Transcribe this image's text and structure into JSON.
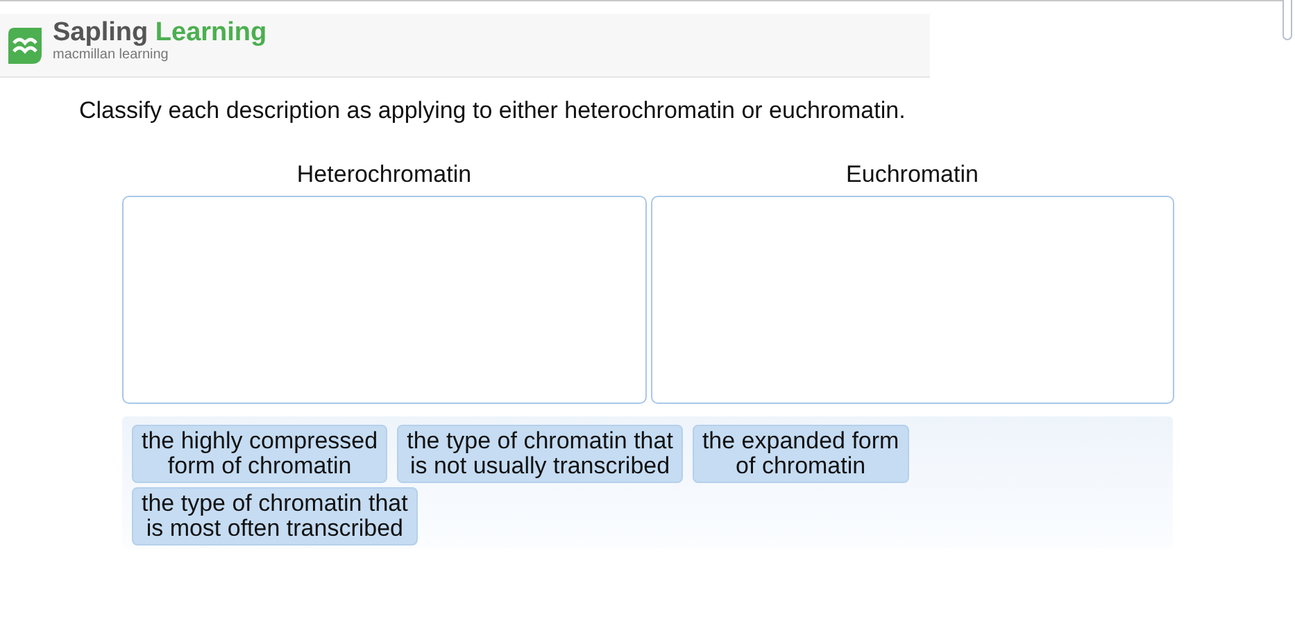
{
  "header": {
    "brand_primary": "Sapling",
    "brand_secondary": "Learning",
    "tagline": "macmillan learning"
  },
  "question": "Classify each description as applying to either heterochromatin or euchromatin.",
  "bins": [
    {
      "label": "Heterochromatin"
    },
    {
      "label": "Euchromatin"
    }
  ],
  "chips": [
    {
      "text": "the highly compressed\nform of chromatin"
    },
    {
      "text": "the type of chromatin that\nis not usually transcribed"
    },
    {
      "text": "the expanded form\nof chromatin"
    },
    {
      "text": "the type of chromatin that\nis most often transcribed"
    }
  ]
}
